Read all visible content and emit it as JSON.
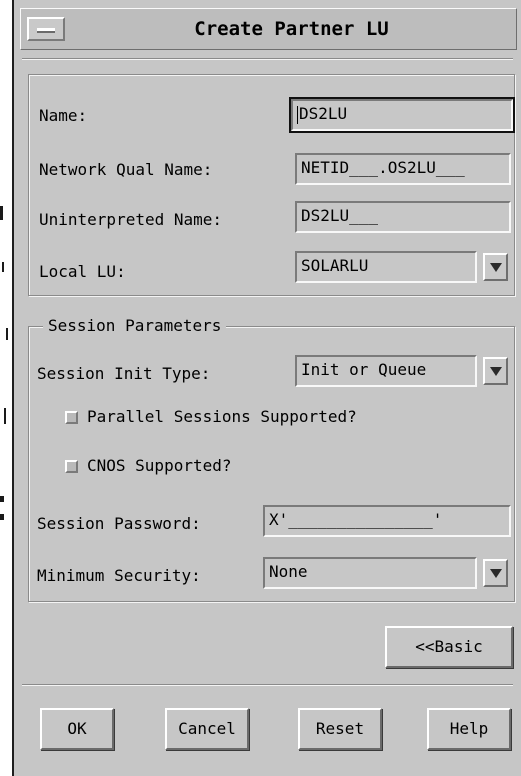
{
  "window": {
    "title": "Create Partner LU"
  },
  "fields": {
    "name": {
      "label": "Name:",
      "value": "DS2LU"
    },
    "network_qual_name": {
      "label": "Network Qual Name:",
      "value": "NETID___.OS2LU___"
    },
    "uninterpreted_name": {
      "label": "Uninterpreted Name:",
      "value": "DS2LU___"
    },
    "local_lu": {
      "label": "Local LU:",
      "value": "SOLARLU"
    }
  },
  "session": {
    "group_title": "Session Parameters",
    "init_type": {
      "label": "Session Init Type:",
      "value": "Init or Queue"
    },
    "parallel_sessions": {
      "label": "Parallel Sessions Supported?",
      "checked": false
    },
    "cnos": {
      "label": "CNOS Supported?",
      "checked": false
    },
    "password": {
      "label": "Session Password:",
      "value": "X'_______________'"
    },
    "min_security": {
      "label": "Minimum Security:",
      "value": "None"
    }
  },
  "buttons": {
    "basic": "<<Basic",
    "ok": "OK",
    "cancel": "Cancel",
    "reset": "Reset",
    "help": "Help"
  }
}
